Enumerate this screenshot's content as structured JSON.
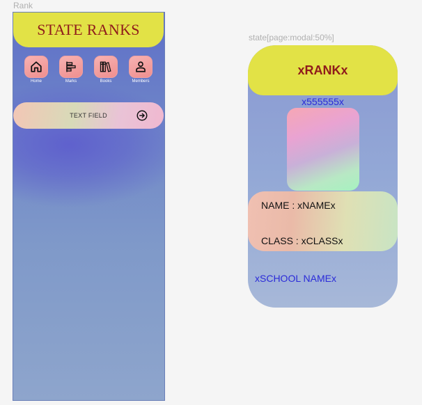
{
  "labels": {
    "frame_rank": "Rank",
    "frame_modal": "state[page:modal:50%]"
  },
  "phone": {
    "title": "STATE RANKS",
    "nav": [
      {
        "label": "Home",
        "icon": "home-icon"
      },
      {
        "label": "Marks",
        "icon": "bar-chart-icon"
      },
      {
        "label": "Books",
        "icon": "books-icon"
      },
      {
        "label": "Members",
        "icon": "person-icon"
      }
    ],
    "text_field": {
      "placeholder": "TEXT FIELD",
      "icon": "arrow-right-circle-icon"
    }
  },
  "modal": {
    "rank": "xRANKx",
    "id": "x555555x",
    "name_line": "NAME :  xNAMEx",
    "class_line": "CLASS : xCLASSx",
    "school": "xSCHOOL NAMEx"
  },
  "colors": {
    "header_yellow": "#e2e246",
    "title_red": "#8f1b1b",
    "link_blue": "#2a2ad9",
    "nav_pink": "#ef8f8f"
  }
}
